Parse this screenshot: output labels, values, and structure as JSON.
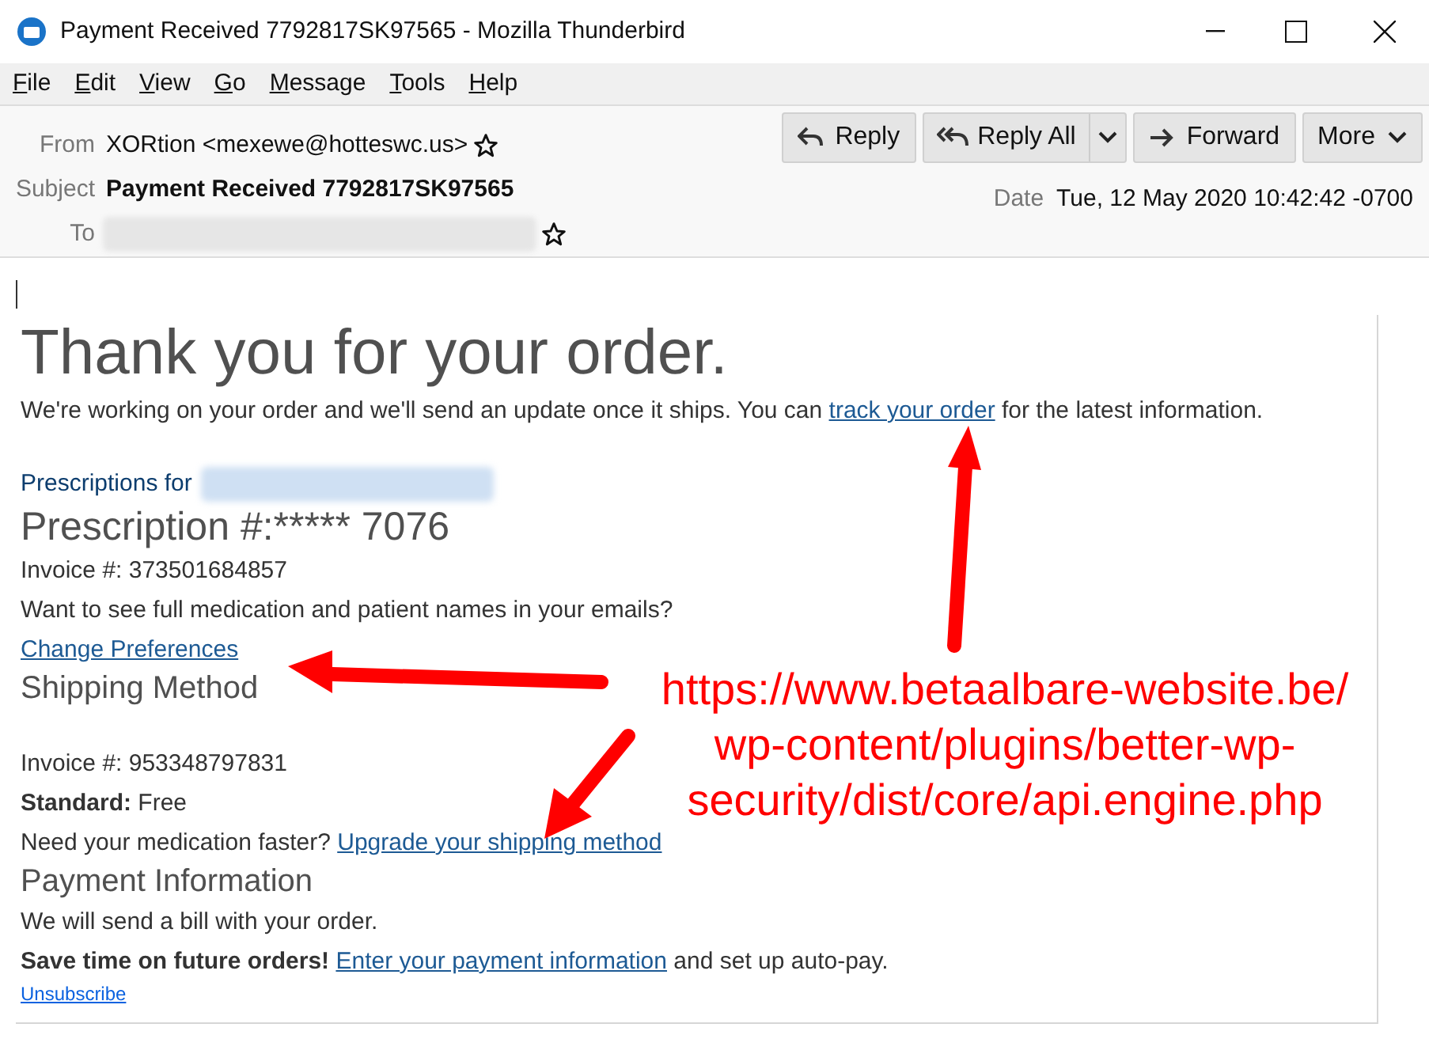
{
  "window": {
    "title": "Payment Received 7792817SK97565 - Mozilla Thunderbird"
  },
  "menu": [
    "File",
    "Edit",
    "View",
    "Go",
    "Message",
    "Tools",
    "Help"
  ],
  "header": {
    "from_label": "From",
    "from": "XORtion <mexewe@hotteswc.us>",
    "subject_label": "Subject",
    "subject": "Payment Received 7792817SK97565",
    "to_label": "To",
    "date_label": "Date",
    "date": "Tue, 12 May 2020 10:42:42 -0700"
  },
  "toolbar": [
    {
      "label": "Reply",
      "kind": "reply"
    },
    {
      "label": "Reply All",
      "kind": "reply_all"
    },
    {
      "label": "Forward",
      "kind": "forward"
    },
    {
      "label": "More",
      "kind": "more"
    }
  ],
  "email": [
    {
      "kind": "title",
      "segments": [
        {
          "text": "Thank you for your order.",
          "kind": "plain"
        }
      ]
    },
    {
      "kind": "text",
      "segments": [
        {
          "text": "We're working on your order and we'll send an update once it ships. You can ",
          "kind": "plain"
        },
        {
          "text": "track your order",
          "kind": "link"
        },
        {
          "text": " for the latest information.",
          "kind": "plain"
        }
      ]
    },
    {
      "kind": "gap"
    },
    {
      "kind": "recipient",
      "segments": [
        {
          "text": "Prescriptions for",
          "kind": "plain"
        }
      ]
    },
    {
      "kind": "heading",
      "segments": [
        {
          "text": "Prescription #:***** 7076",
          "kind": "plain"
        }
      ]
    },
    {
      "kind": "text",
      "segments": [
        {
          "text": "Invoice #: 373501684857",
          "kind": "plain"
        }
      ]
    },
    {
      "kind": "text",
      "segments": [
        {
          "text": "Want to see full medication and patient names in your emails?",
          "kind": "plain"
        }
      ]
    },
    {
      "kind": "text",
      "segments": [
        {
          "text": "Change Preferences",
          "kind": "link"
        }
      ]
    },
    {
      "kind": "subheading",
      "segments": [
        {
          "text": "Shipping Method",
          "kind": "plain"
        }
      ]
    },
    {
      "kind": "gap"
    },
    {
      "kind": "text",
      "segments": [
        {
          "text": "Invoice #: 953348797831",
          "kind": "plain"
        }
      ]
    },
    {
      "kind": "text",
      "segments": [
        {
          "text": "**Standard:** Free",
          "kind": "rich"
        }
      ]
    },
    {
      "kind": "text",
      "segments": [
        {
          "text": "Need your medication faster? ",
          "kind": "plain"
        },
        {
          "text": "Upgrade your shipping method",
          "kind": "link"
        }
      ]
    },
    {
      "kind": "subheading",
      "segments": [
        {
          "text": "Payment Information",
          "kind": "plain"
        }
      ]
    },
    {
      "kind": "text",
      "segments": [
        {
          "text": "We will send a bill with your order.",
          "kind": "plain"
        }
      ]
    },
    {
      "kind": "text",
      "segments": [
        {
          "text": "Save time on future orders! ",
          "kind": "bold"
        },
        {
          "text": "Enter your payment information",
          "kind": "link"
        },
        {
          "text": " and set up auto-pay.",
          "kind": "plain"
        }
      ]
    },
    {
      "kind": "small",
      "segments": [
        {
          "text": "Unsubscribe",
          "kind": "smalllink"
        }
      ]
    }
  ],
  "annotation": {
    "lines": [
      "https://www.betaalbare-website.be/",
      "wp-content/plugins/better-wp-",
      "security/dist/core/api.engine.php"
    ]
  }
}
